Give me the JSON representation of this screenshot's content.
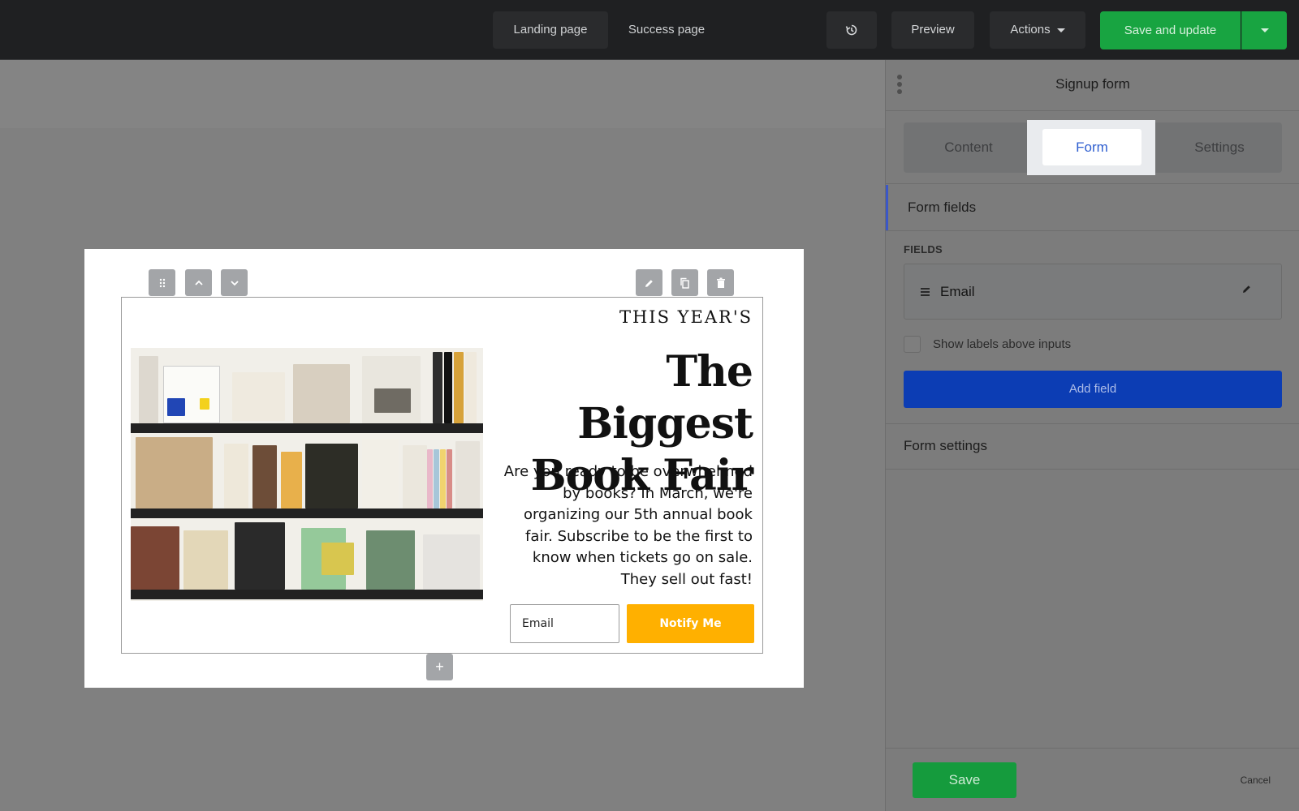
{
  "topbar": {
    "tabs": [
      {
        "label": "Landing page"
      },
      {
        "label": "Success page"
      }
    ],
    "history_icon": "history-icon",
    "preview_label": "Preview",
    "actions_label": "Actions",
    "save_update_label": "Save and update"
  },
  "canvas": {
    "eyebrow": "THIS YEAR'S",
    "headline_line1": "The Biggest",
    "headline_line2": "Book Fair",
    "body": "Are you ready to be overwhelmed by books? In March, we're organizing our 5th annual book fair. Subscribe to be the first to know when tickets go on sale. They sell out fast!",
    "email_placeholder": "Email",
    "notify_label": "Notify Me",
    "button_color": "#ffb000"
  },
  "panel": {
    "title": "Signup form",
    "tabs": {
      "content": "Content",
      "form": "Form",
      "settings": "Settings"
    },
    "form_fields_title": "Form fields",
    "fields_label": "FIELDS",
    "fields": [
      {
        "label": "Email"
      }
    ],
    "show_labels_text": "Show labels above inputs",
    "add_field_label": "Add field",
    "form_settings_title": "Form settings",
    "save_label": "Save",
    "cancel_label": "Cancel"
  },
  "colors": {
    "primary_green": "#18a441",
    "add_field_blue": "#0c3db4",
    "active_tab_text": "#2f5fd0"
  }
}
